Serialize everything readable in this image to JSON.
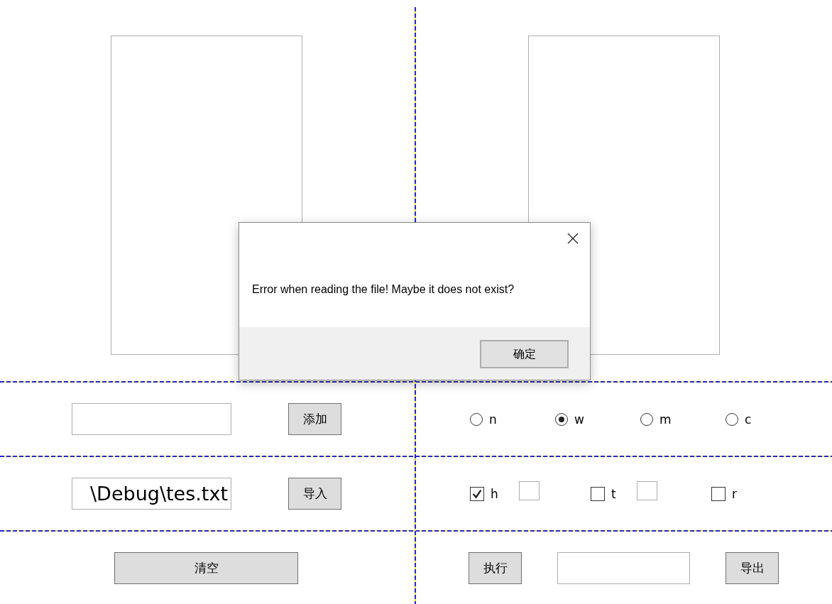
{
  "add_button": "添加",
  "path_field": {
    "value": "\\Debug\\tes.txt"
  },
  "import_button": "导入",
  "clear_button": "清空",
  "radio_options": [
    {
      "label": "n",
      "selected": false
    },
    {
      "label": "w",
      "selected": true
    },
    {
      "label": "m",
      "selected": false
    },
    {
      "label": "c",
      "selected": false
    }
  ],
  "checkboxes": [
    {
      "label": "h",
      "checked": true,
      "kind": "with-field"
    },
    {
      "label": "t",
      "checked": false,
      "kind": "with-field"
    },
    {
      "label": "r",
      "checked": false,
      "kind": "plain"
    }
  ],
  "run_button": "执行",
  "export_button": "导出",
  "dialog": {
    "message": "Error when reading the file! Maybe it does not exist?",
    "ok_button": "确定"
  }
}
